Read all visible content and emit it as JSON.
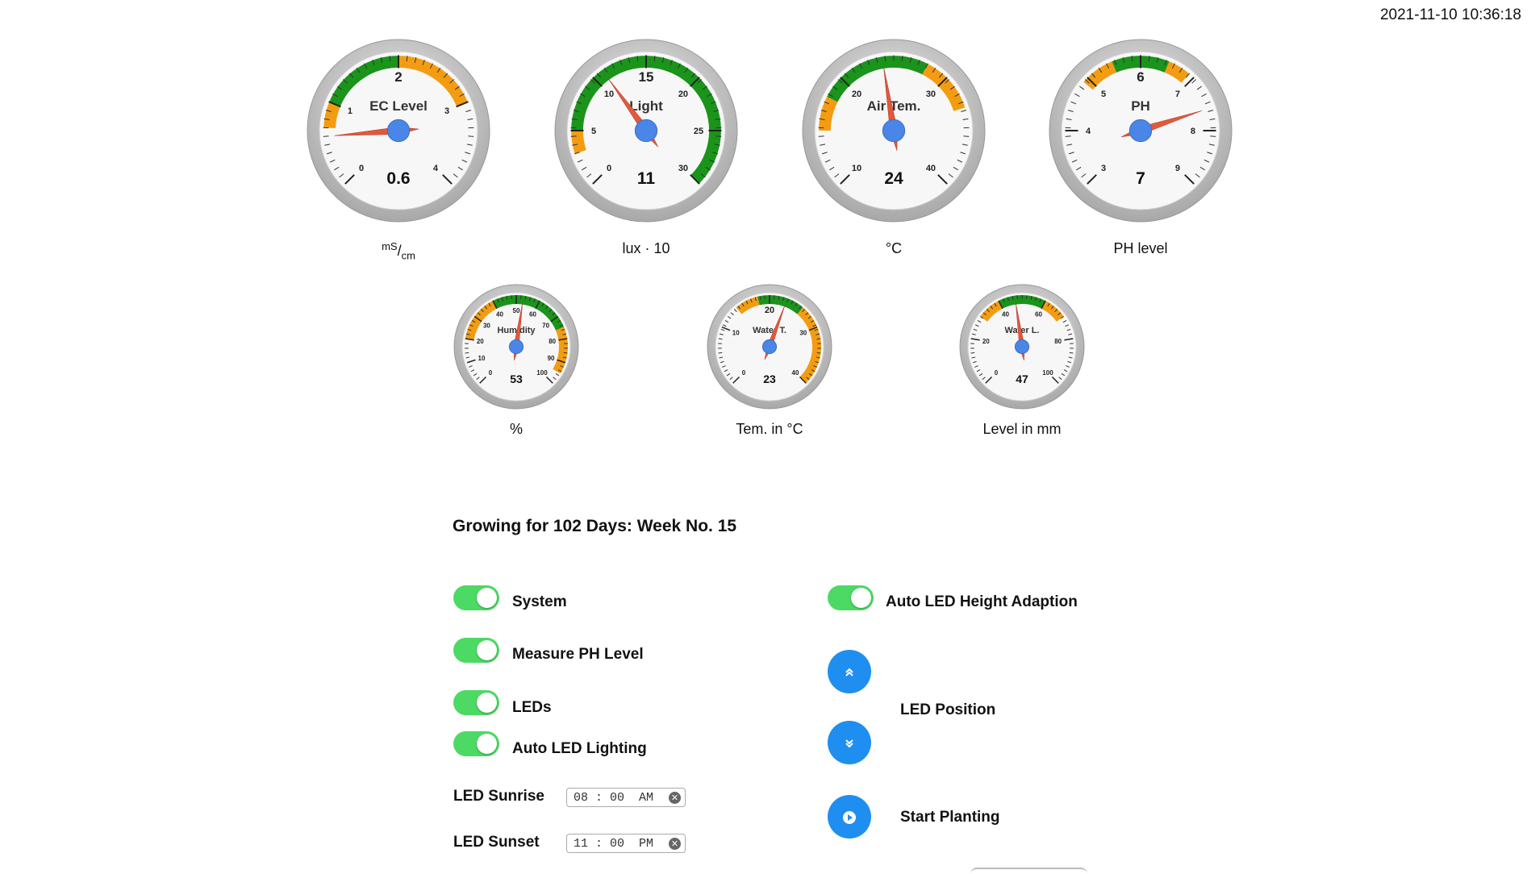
{
  "datetime": "2021-11-10 10:36:18",
  "gauges": [
    {
      "id": "ec",
      "title": "EC Level",
      "value": "0.6",
      "unit_main": "mS",
      "unit_sup": "",
      "unit_sub": "cm",
      "unit_sep": "/",
      "needle": 0.6,
      "min": 0,
      "max": 4,
      "ticks": [
        {
          "v": 0,
          "t": "0"
        },
        {
          "v": 1,
          "t": "1"
        },
        {
          "v": 2,
          "t": "2",
          "big": true
        },
        {
          "v": 3,
          "t": "3"
        },
        {
          "v": 4,
          "t": "4"
        }
      ],
      "zones": [
        {
          "from": 0.7,
          "to": 1.0,
          "color": "#f39c12"
        },
        {
          "from": 1.0,
          "to": 2.0,
          "color": "#1a941a"
        },
        {
          "from": 2.0,
          "to": 3.0,
          "color": "#f39c12"
        }
      ]
    },
    {
      "id": "light",
      "title": "Light",
      "value": "11",
      "unit_text": "lux · 10",
      "needle": 11,
      "min": 0,
      "max": 30,
      "ticks": [
        {
          "v": 0,
          "t": "0"
        },
        {
          "v": 5,
          "t": "5"
        },
        {
          "v": 10,
          "t": "10"
        },
        {
          "v": 15,
          "t": "15",
          "big": true
        },
        {
          "v": 20,
          "t": "20"
        },
        {
          "v": 25,
          "t": "25"
        },
        {
          "v": 30,
          "t": "30"
        }
      ],
      "zones": [
        {
          "from": 3,
          "to": 5,
          "color": "#f39c12"
        },
        {
          "from": 5,
          "to": 30,
          "color": "#1a941a"
        }
      ]
    },
    {
      "id": "air",
      "title": "Air Tem.",
      "value": "24",
      "unit_text": "°C",
      "needle": 24,
      "min": 10,
      "max": 40,
      "ticks": [
        {
          "v": 10,
          "t": "10"
        },
        {
          "v": 20,
          "t": "20"
        },
        {
          "v": 30,
          "t": "30"
        },
        {
          "v": 40,
          "t": "40"
        }
      ],
      "zones": [
        {
          "from": 15,
          "to": 18,
          "color": "#f39c12"
        },
        {
          "from": 18,
          "to": 28,
          "color": "#1a941a"
        },
        {
          "from": 28,
          "to": 33,
          "color": "#f39c12"
        }
      ]
    },
    {
      "id": "ph",
      "title": "PH",
      "value": "7",
      "unit_text": "PH level",
      "needle": 7.6,
      "min": 3,
      "max": 9,
      "ticks": [
        {
          "v": 3,
          "t": "3"
        },
        {
          "v": 4,
          "t": "4"
        },
        {
          "v": 5,
          "t": "5"
        },
        {
          "v": 6,
          "t": "6",
          "big": true
        },
        {
          "v": 7,
          "t": "7"
        },
        {
          "v": 8,
          "t": "8"
        },
        {
          "v": 9,
          "t": "9"
        }
      ],
      "zones": [
        {
          "from": 4.9,
          "to": 5.5,
          "color": "#f39c12"
        },
        {
          "from": 5.5,
          "to": 6.5,
          "color": "#1a941a"
        },
        {
          "from": 6.5,
          "to": 6.9,
          "color": "#f39c12"
        }
      ]
    },
    {
      "id": "humidity",
      "title": "Humidity",
      "value": "53",
      "unit_text": "%",
      "needle": 53,
      "min": 0,
      "max": 100,
      "ticks": [
        {
          "v": 0,
          "t": "0"
        },
        {
          "v": 10,
          "t": "10"
        },
        {
          "v": 20,
          "t": "20"
        },
        {
          "v": 30,
          "t": "30"
        },
        {
          "v": 40,
          "t": "40"
        },
        {
          "v": 50,
          "t": "50"
        },
        {
          "v": 60,
          "t": "60"
        },
        {
          "v": 70,
          "t": "70"
        },
        {
          "v": 80,
          "t": "80"
        },
        {
          "v": 90,
          "t": "90"
        },
        {
          "v": 100,
          "t": "100"
        }
      ],
      "zones": [
        {
          "from": 20,
          "to": 40,
          "color": "#f39c12"
        },
        {
          "from": 40,
          "to": 75,
          "color": "#1a941a"
        },
        {
          "from": 75,
          "to": 95,
          "color": "#f39c12"
        }
      ]
    },
    {
      "id": "water_t",
      "title": "Water T.",
      "value": "23",
      "unit_text": "Tem. in °C",
      "needle": 23,
      "min": 0,
      "max": 40,
      "ticks": [
        {
          "v": 0,
          "t": "0"
        },
        {
          "v": 10,
          "t": "10"
        },
        {
          "v": 20,
          "t": "20",
          "big": true
        },
        {
          "v": 30,
          "t": "30"
        },
        {
          "v": 40,
          "t": "40"
        }
      ],
      "zones": [
        {
          "from": 14,
          "to": 18,
          "color": "#f39c12"
        },
        {
          "from": 18,
          "to": 26,
          "color": "#1a941a"
        },
        {
          "from": 26,
          "to": 40,
          "color": "#f39c12"
        }
      ]
    },
    {
      "id": "water_l",
      "title": "Water L.",
      "value": "47",
      "unit_text": "Level in mm",
      "needle": 47,
      "min": 0,
      "max": 100,
      "ticks": [
        {
          "v": 0,
          "t": "0"
        },
        {
          "v": 20,
          "t": "20"
        },
        {
          "v": 40,
          "t": "40"
        },
        {
          "v": 60,
          "t": "60"
        },
        {
          "v": 80,
          "t": "80"
        },
        {
          "v": 100,
          "t": "100"
        }
      ],
      "zones": [
        {
          "from": 30,
          "to": 40,
          "color": "#f39c12"
        },
        {
          "from": 40,
          "to": 60,
          "color": "#1a941a"
        },
        {
          "from": 60,
          "to": 70,
          "color": "#f39c12"
        }
      ]
    }
  ],
  "growing_text": "Growing for 102 Days: Week No. 15",
  "toggles": {
    "system": {
      "label": "System",
      "on": true
    },
    "measure_ph": {
      "label": "Measure PH Level",
      "on": true
    },
    "leds": {
      "label": "LEDs",
      "on": true
    },
    "auto_led_lighting": {
      "label": "Auto LED Lighting",
      "on": true
    },
    "auto_led_height": {
      "label": "Auto LED Height Adaption",
      "on": true
    }
  },
  "sunrise": {
    "label": "LED Sunrise",
    "value": "08 : 00  AM"
  },
  "sunset": {
    "label": "LED Sunset",
    "value": "11 : 00  PM"
  },
  "led_position_label": "LED Position",
  "start_planting_label": "Start Planting",
  "icons": {
    "up": "chevron-double-up-icon",
    "down": "chevron-double-down-icon",
    "play": "play-icon",
    "clear": "clear-icon"
  },
  "colors": {
    "zone_ok": "#1a941a",
    "zone_warn": "#f39c12",
    "needle": "#e05a3a",
    "hub": "#4a86e8",
    "toggle_on": "#4cd964",
    "button": "#1e8ff0"
  }
}
